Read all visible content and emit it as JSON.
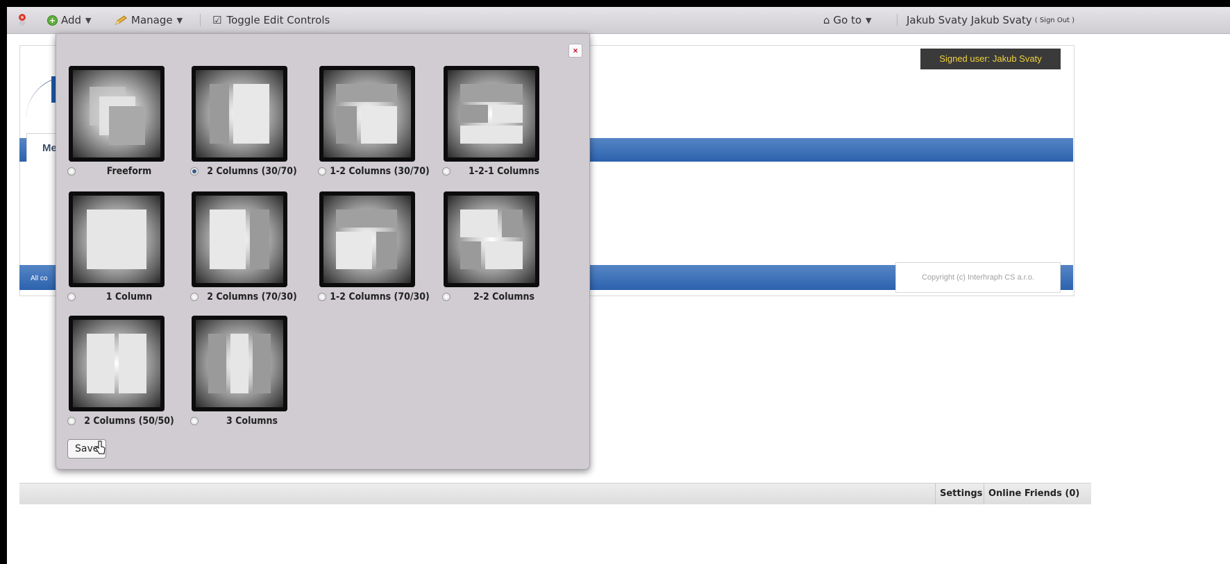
{
  "dockbar": {
    "add_label": "Add",
    "manage_label": "Manage",
    "toggle_label": "Toggle Edit Controls",
    "goto_label": "Go to",
    "user_name": "Jakub Svaty Jakub Svaty",
    "signout": "( Sign Out )"
  },
  "page": {
    "signed_user": "Signed user: Jakub Svaty",
    "nav_tab": "Me",
    "footer_text": "All co",
    "copyright": "Copyright (c) Interhraph CS a.r.o."
  },
  "layout_dialog": {
    "close_symbol": "×",
    "options": [
      {
        "label": "Freeform",
        "selected": false,
        "icon": "freeform-layout-icon"
      },
      {
        "label": "2 Columns (30/70)",
        "selected": true,
        "icon": "two-columns-30-70-icon"
      },
      {
        "label": "1-2 Columns (30/70)",
        "selected": false,
        "icon": "one-two-columns-30-70-icon"
      },
      {
        "label": "1-2-1 Columns",
        "selected": false,
        "icon": "one-two-one-columns-icon"
      },
      {
        "label": "1 Column",
        "selected": false,
        "icon": "one-column-icon"
      },
      {
        "label": "2 Columns (70/30)",
        "selected": false,
        "icon": "two-columns-70-30-icon"
      },
      {
        "label": "1-2 Columns (70/30)",
        "selected": false,
        "icon": "one-two-columns-70-30-icon"
      },
      {
        "label": "2-2 Columns",
        "selected": false,
        "icon": "two-two-columns-icon"
      },
      {
        "label": "2 Columns (50/50)",
        "selected": false,
        "icon": "two-columns-50-50-icon"
      },
      {
        "label": "3 Columns",
        "selected": false,
        "icon": "three-columns-icon"
      }
    ],
    "save_label": "Save"
  },
  "bottom_bar": {
    "settings": "Settings",
    "online_friends": "Online Friends (0)"
  }
}
